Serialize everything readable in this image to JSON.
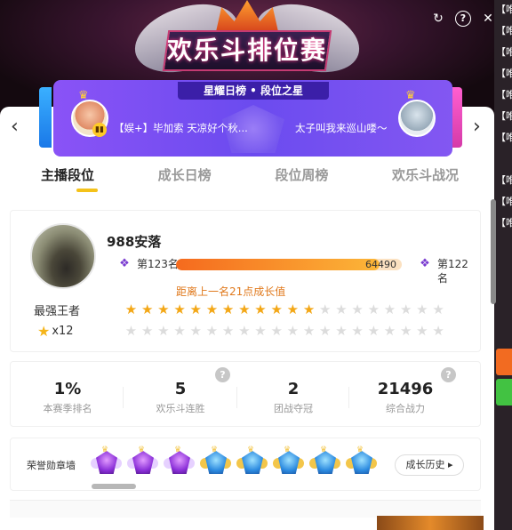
{
  "window": {
    "banner_title": "欢乐斗排位赛",
    "icons": [
      "refresh-icon",
      "help-icon",
      "close-icon"
    ]
  },
  "background_strip": {
    "items": [
      "【唯",
      "【唯",
      "【唯",
      "【唯",
      "【唯",
      "【唯",
      "【唯",
      "【唯",
      "【唯",
      "【唯"
    ]
  },
  "carousel": {
    "title": "星耀日榜 • 段位之星",
    "left_name": "【娱+】毕加索 天凉好个秋...",
    "right_name": "太子叫我来巡山喽～"
  },
  "tabs": [
    {
      "label": "主播段位",
      "active": true
    },
    {
      "label": "成长日榜",
      "active": false
    },
    {
      "label": "段位周榜",
      "active": false
    },
    {
      "label": "欢乐斗战况",
      "active": false
    }
  ],
  "profile": {
    "nickname": "988安落",
    "rank_title": "最强王者",
    "star_multiplier": "x12",
    "current_rank": "第123名",
    "next_rank": "第122名",
    "growth_value": "64490",
    "progress": 0.9,
    "gap_note": "距离上一名21点成长值",
    "stars_total": 40,
    "stars_lit": 12
  },
  "stats": [
    {
      "value": "1%",
      "label": "本赛季排名"
    },
    {
      "value": "5",
      "label": "欢乐斗连胜"
    },
    {
      "value": "2",
      "label": "团战夺冠"
    },
    {
      "value": "21496",
      "label": "综合战力"
    }
  ],
  "honor": {
    "label": "荣誉勋章墙",
    "medals": [
      "purple",
      "purple",
      "purple",
      "blue",
      "blue",
      "blue",
      "blue",
      "blue"
    ],
    "history_button": "成长历史"
  },
  "colors": {
    "accent_yellow": "#f4c21a",
    "progress_start": "#f56a1e",
    "progress_end": "#fcb638",
    "gap_note": "#e0791c",
    "carousel_bg": "#7b52f2"
  }
}
